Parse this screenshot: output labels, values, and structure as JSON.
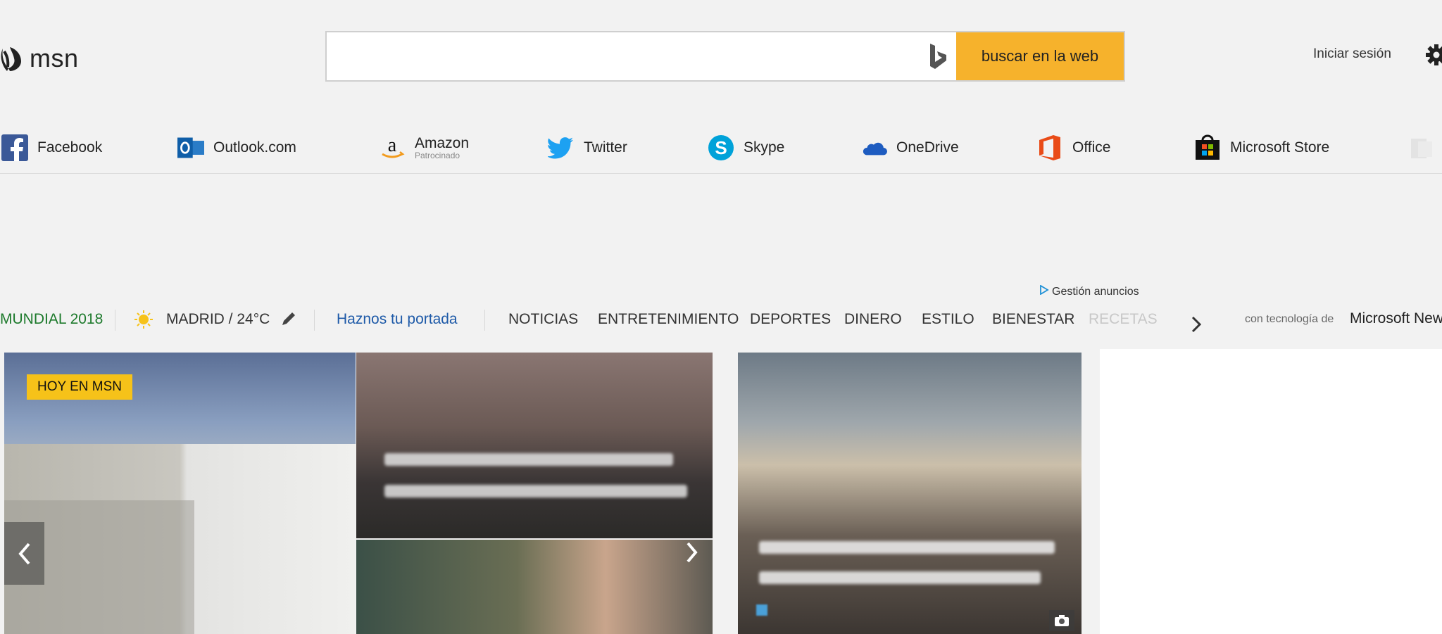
{
  "header": {
    "logo_text": "msn",
    "search": {
      "value": "",
      "placeholder": "",
      "button_label": "buscar en la web",
      "engine_icon": "bing-icon"
    },
    "signin_label": "Iniciar sesión",
    "settings_icon": "gear-icon"
  },
  "quick_links": [
    {
      "label": "Facebook",
      "icon": "facebook-icon"
    },
    {
      "label": "Outlook.com",
      "icon": "outlook-icon"
    },
    {
      "label": "Amazon",
      "sublabel": "Patrocinado",
      "icon": "amazon-icon"
    },
    {
      "label": "Twitter",
      "icon": "twitter-icon"
    },
    {
      "label": "Skype",
      "icon": "skype-icon"
    },
    {
      "label": "OneDrive",
      "icon": "onedrive-icon"
    },
    {
      "label": "Office",
      "icon": "office-icon"
    },
    {
      "label": "Microsoft Store",
      "icon": "store-icon"
    }
  ],
  "ads": {
    "manage_label": "Gestión anuncios"
  },
  "nav": {
    "feature": "MUNDIAL 2018",
    "weather": {
      "location": "MADRID / 24°C",
      "icon": "sun-icon"
    },
    "portal_label": "Haznos tu portada",
    "categories": [
      "NOTICIAS",
      "ENTRETENIMIENTO",
      "DEPORTES",
      "DINERO",
      "ESTILO",
      "BIENESTAR",
      "RECETAS"
    ],
    "more_icon": "chevron-right-icon",
    "powered_by": "con tecnología de",
    "powered_brand": "Microsoft News"
  },
  "hero": {
    "badge": "HOY EN MSN"
  },
  "colors": {
    "accent": "#f6b22c",
    "badge": "#f6c219",
    "feature": "#1d7a2c",
    "link": "#1e5aa8"
  }
}
